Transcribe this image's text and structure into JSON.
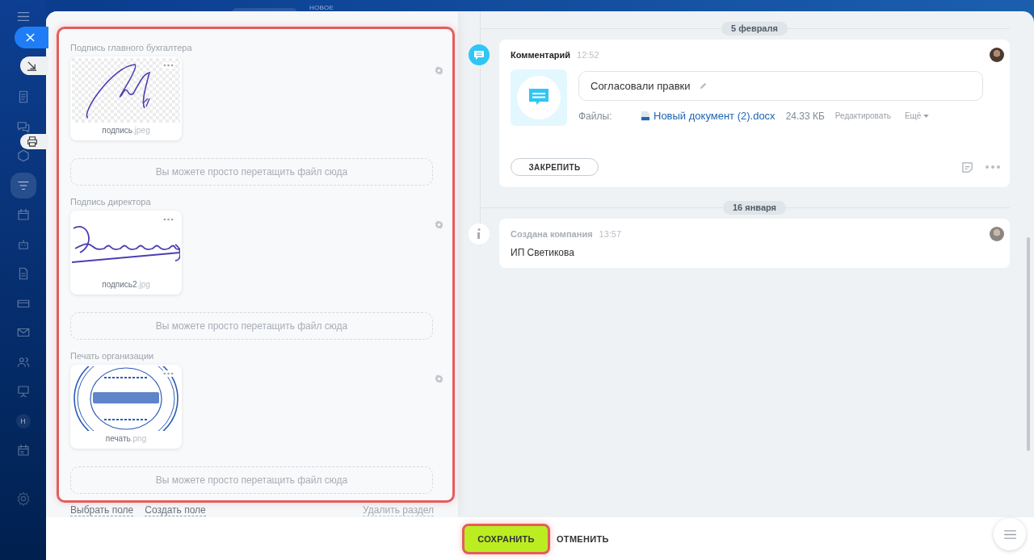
{
  "top_strip": {
    "badge": "НОВОЕ"
  },
  "sidebar": {
    "items": [
      {
        "selected": false
      },
      {
        "selected": false
      },
      {
        "selected": false
      },
      {
        "selected": true
      },
      {
        "selected": false
      },
      {
        "selected": false
      },
      {
        "selected": false
      },
      {
        "selected": false
      },
      {
        "selected": false
      },
      {
        "selected": false
      },
      {
        "selected": false
      },
      {
        "selected": false,
        "letter": "H"
      },
      {
        "selected": false
      }
    ]
  },
  "section": {
    "fields": [
      {
        "label": "Подпись главного бухгалтера",
        "file_name": "подпись",
        "file_ext": ".jpeg",
        "dropzone": "Вы можете просто перетащить файл сюда"
      },
      {
        "label": "Подпись директора",
        "file_name": "подпись2",
        "file_ext": ".jpg",
        "dropzone": "Вы можете просто перетащить файл сюда"
      },
      {
        "label": "Печать организации",
        "file_name": "печать",
        "file_ext": ".png",
        "dropzone": "Вы можете просто перетащить файл сюда"
      }
    ],
    "links": [
      "Выбрать поле",
      "Создать поле"
    ],
    "delete_link": "Удалить раздел"
  },
  "timeline": [
    {
      "kind": "date",
      "text": "5 февраля"
    },
    {
      "kind": "comment",
      "title": "Комментарий",
      "time": "12:52",
      "text": "Согласовали правки",
      "files_label": "Файлы:",
      "file": "Новый документ (2).docx",
      "size": "24.33 КБ",
      "edit": "Редактировать",
      "more": "Ещё",
      "pin": "ЗАКРЕПИТЬ"
    },
    {
      "kind": "date",
      "text": "16 января"
    },
    {
      "kind": "info",
      "title": "Создана компания",
      "time": "13:57",
      "text": "ИП Светикова"
    }
  ],
  "footer": {
    "save": "СОХРАНИТЬ",
    "cancel": "ОТМЕНИТЬ"
  }
}
